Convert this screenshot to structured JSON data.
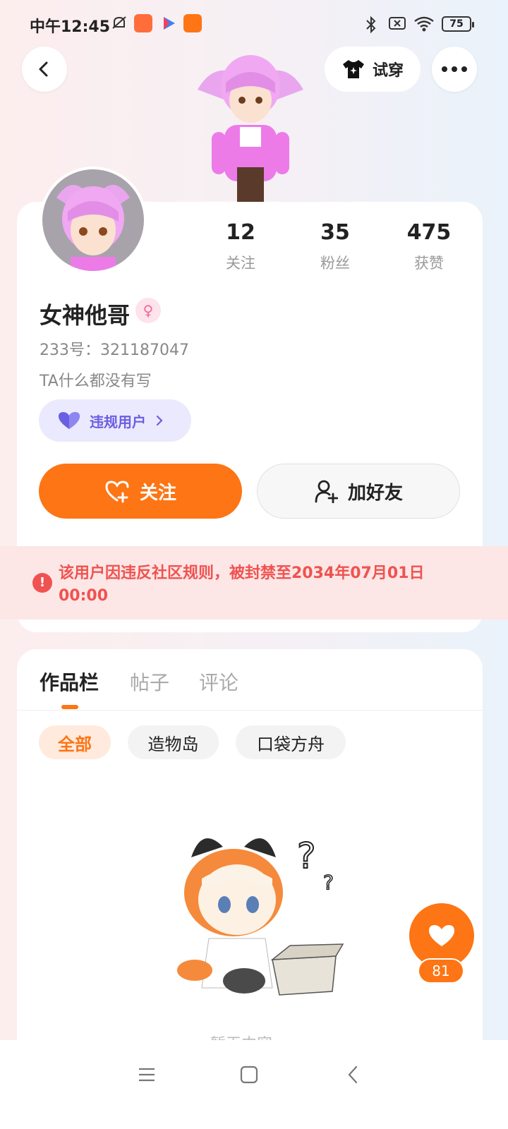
{
  "status_bar": {
    "time": "中午12:45",
    "battery": "75"
  },
  "header": {
    "try_on_label": "试穿"
  },
  "profile": {
    "stats": [
      {
        "value": "12",
        "label": "关注"
      },
      {
        "value": "35",
        "label": "粉丝"
      },
      {
        "value": "475",
        "label": "获赞"
      }
    ],
    "username": "女神他哥",
    "gender_symbol": "♀",
    "uid": "233号：321187047",
    "bio": "TA什么都没有写",
    "badge_label": "违规用户",
    "follow_label": "关注",
    "add_friend_label": "加好友"
  },
  "ban_notice": {
    "text": "该用户因违反社区规则，被封禁至2034年07月01日 00:00"
  },
  "works": {
    "tabs": [
      "作品栏",
      "帖子",
      "评论"
    ],
    "filters": [
      "全部",
      "造物岛",
      "口袋方舟"
    ],
    "empty_text": "暂无内容"
  },
  "like": {
    "count": "81"
  },
  "colors": {
    "accent": "#fd7514",
    "ban_text": "#ef5350",
    "badge_text": "#6a5ee3"
  }
}
